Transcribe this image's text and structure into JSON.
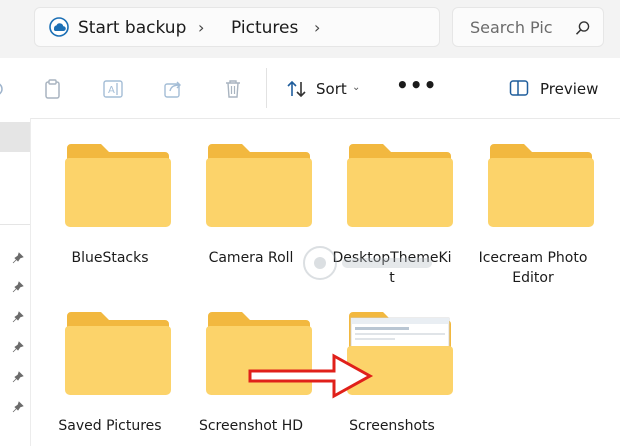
{
  "address_bar": {
    "crumbs": [
      "Start backup",
      "Pictures"
    ],
    "search_placeholder": "Search Pic"
  },
  "toolbar": {
    "sort_label": "Sort",
    "more_label": "•••",
    "preview_label": "Preview"
  },
  "folders": [
    {
      "name": "BlueStacks"
    },
    {
      "name": "Camera Roll"
    },
    {
      "name": "DesktopThemeKi\nt"
    },
    {
      "name": "Icecream Photo\nEditor"
    },
    {
      "name": "Saved Pictures"
    },
    {
      "name": "Screenshot HD"
    },
    {
      "name": "Screenshots"
    }
  ],
  "colors": {
    "folder_front": "#fcd36a",
    "folder_back": "#f2b83f",
    "arrow": "#e0201a",
    "accent_blue": "#0f6cbd"
  }
}
